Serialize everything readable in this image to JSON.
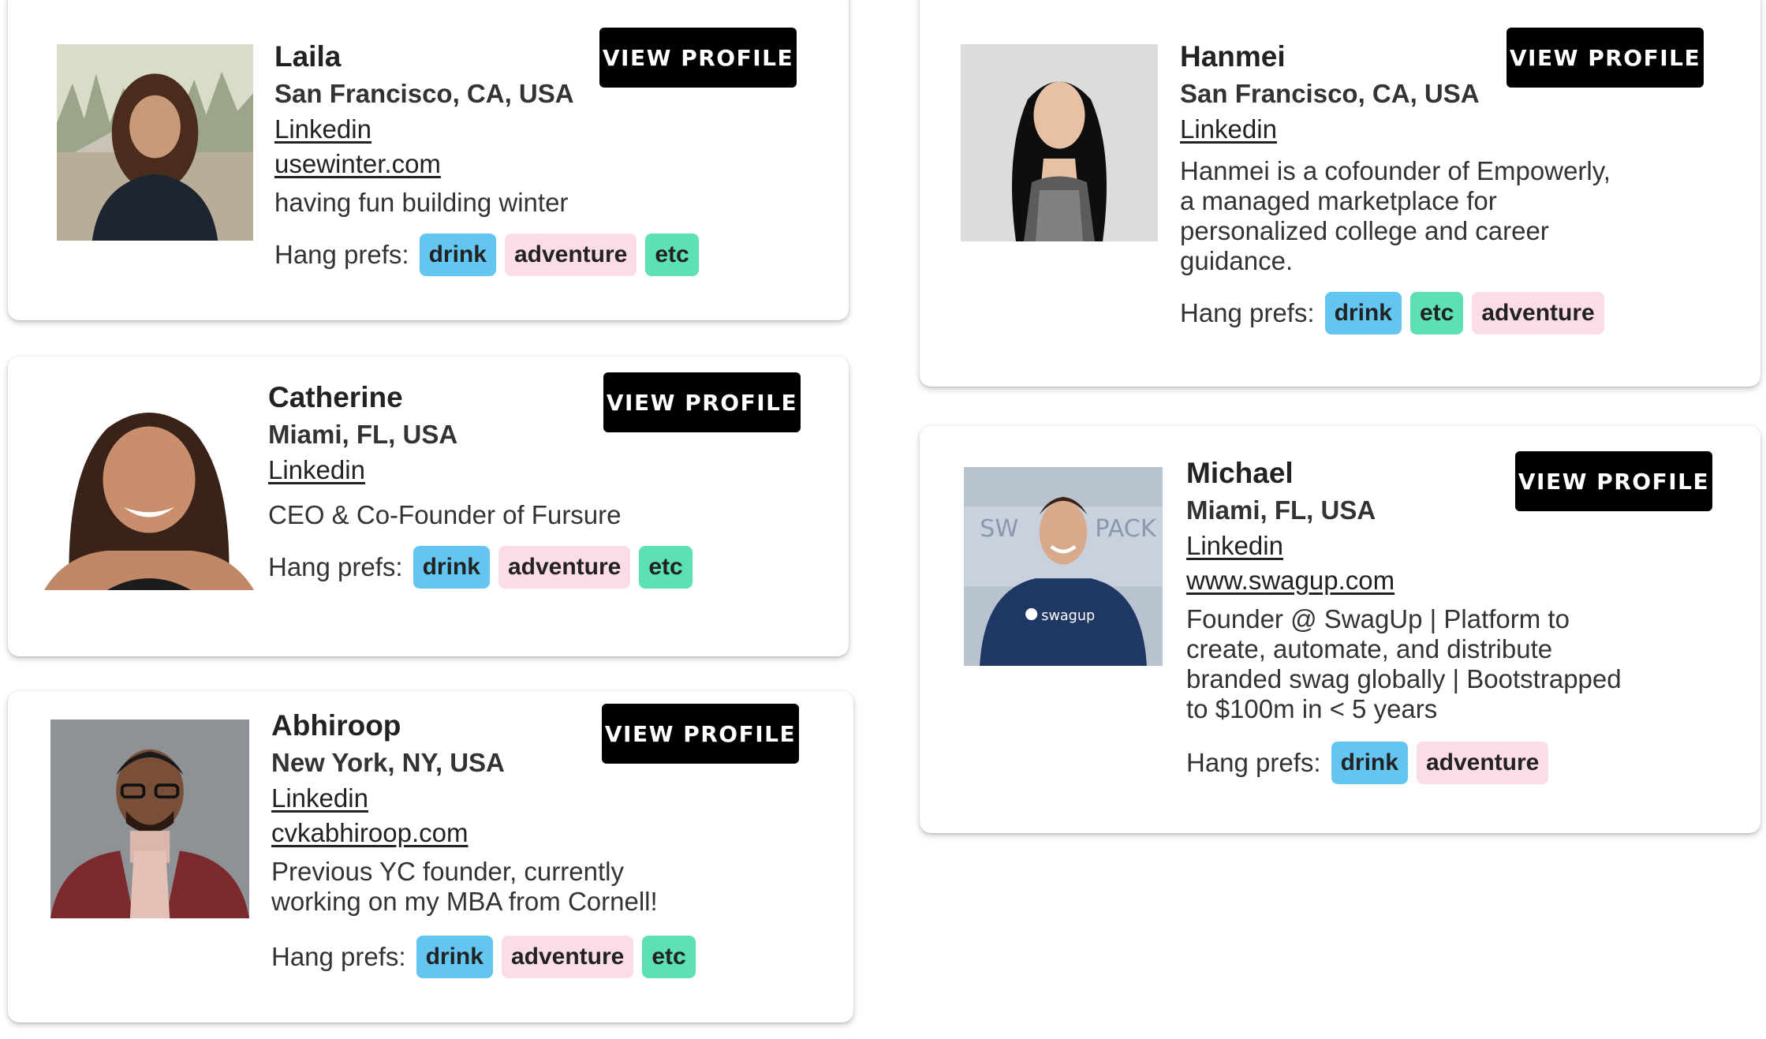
{
  "common": {
    "view_profile_label": "VIEW PROFILE",
    "hang_prefs_label": "Hang prefs:"
  },
  "tag_colors": {
    "drink": "#63c6f0",
    "adventure": "#fcdde6",
    "etc": "#5ee0b5"
  },
  "profiles": [
    {
      "name": "Laila",
      "location": "San Francisco, CA, USA",
      "linkedin": "Linkedin",
      "website": "usewinter.com",
      "bio": "having fun building winter",
      "prefs": [
        "drink",
        "adventure",
        "etc"
      ]
    },
    {
      "name": "Catherine",
      "location": "Miami, FL, USA",
      "linkedin": "Linkedin",
      "website": "",
      "bio": "CEO & Co-Founder of Fursure",
      "prefs": [
        "drink",
        "adventure",
        "etc"
      ]
    },
    {
      "name": "Abhiroop",
      "location": "New York, NY, USA",
      "linkedin": "Linkedin",
      "website": "cvkabhiroop.com",
      "bio": "Previous YC founder, currently working on my MBA from Cornell!",
      "prefs": [
        "drink",
        "adventure",
        "etc"
      ]
    },
    {
      "name": "Hanmei",
      "location": "San Francisco, CA, USA",
      "linkedin": "Linkedin",
      "website": "",
      "bio": "Hanmei is a cofounder of Empowerly, a managed marketplace for personalized college and career guidance.",
      "prefs": [
        "drink",
        "etc",
        "adventure"
      ]
    },
    {
      "name": "Michael",
      "location": "Miami, FL, USA",
      "linkedin": "Linkedin",
      "website": "www.swagup.com",
      "bio": "Founder @ SwagUp | Platform to create, automate, and distribute branded swag globally | Bootstrapped to $100m in < 5 years",
      "prefs": [
        "drink",
        "adventure"
      ]
    }
  ]
}
